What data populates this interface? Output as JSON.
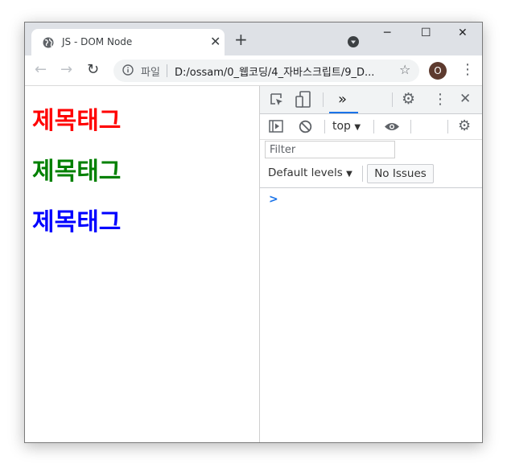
{
  "browser": {
    "tab": {
      "title": "JS - DOM Node",
      "close_icon": "✕"
    },
    "new_tab_icon": "+",
    "window_controls": {
      "minimize": "─",
      "maximize": "☐",
      "close": "✕"
    },
    "toolbar": {
      "back": "←",
      "forward": "→",
      "reload": "↻",
      "scheme": "파일",
      "url": "D:/ossam/0_웹코딩/4_자바스크립트/9_D...",
      "bookmark_icon": "☆",
      "profile_initial": "O",
      "profile_color": "#5d3a2e",
      "menu_icon": "⋮"
    }
  },
  "page": {
    "headings": [
      {
        "text": "제목태그",
        "color": "#ff0000"
      },
      {
        "text": "제목태그",
        "color": "#008000"
      },
      {
        "text": "제목태그",
        "color": "#0000ff"
      }
    ]
  },
  "devtools": {
    "more_tabs_icon": "»",
    "settings_icon": "⚙",
    "menu_icon": "⋮",
    "close_icon": "✕",
    "context": "top",
    "context_arrow": "▼",
    "filter_placeholder": "Filter",
    "levels_label": "Default levels",
    "levels_arrow": "▼",
    "issues_label": "No Issues",
    "prompt_symbol": ">",
    "accent": "#1a73e8"
  }
}
